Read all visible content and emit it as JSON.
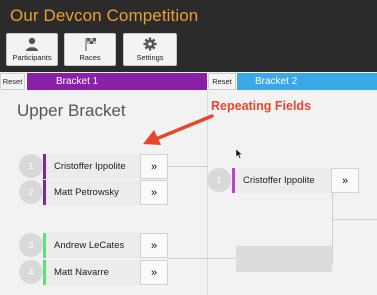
{
  "app": {
    "title": "Our Devcon Competition"
  },
  "nav": [
    {
      "label": "Participants",
      "icon": "person-icon"
    },
    {
      "label": "Races",
      "icon": "checkered-flag-icon"
    },
    {
      "label": "Settings",
      "icon": "gear-icon"
    }
  ],
  "tabs": [
    {
      "reset_label": "Reset",
      "label": "Bracket 1",
      "color": "#8a1fa8"
    },
    {
      "reset_label": "Reset",
      "label": "Bracket 2",
      "color": "#3aa8e6"
    }
  ],
  "section": {
    "title": "Upper Bracket"
  },
  "annotation": {
    "text": "Repeating Fields",
    "color": "#e8452a"
  },
  "round1": [
    {
      "seed": "1",
      "name": "Cristoffer Ippolite",
      "action": "»",
      "group_color": "#7a2a9e"
    },
    {
      "seed": "2",
      "name": "Matt Petrowsky",
      "action": "»",
      "group_color": "#7a2a9e"
    },
    {
      "seed": "3",
      "name": "Andrew LeCates",
      "action": "»",
      "group_color": "#5be07a"
    },
    {
      "seed": "4",
      "name": "Matt Navarre",
      "action": "»",
      "group_color": "#5be07a"
    }
  ],
  "round2": [
    {
      "seed": "1",
      "name": "Cristoffer Ippolite",
      "action": "»",
      "group_color": "#c040d8"
    }
  ]
}
